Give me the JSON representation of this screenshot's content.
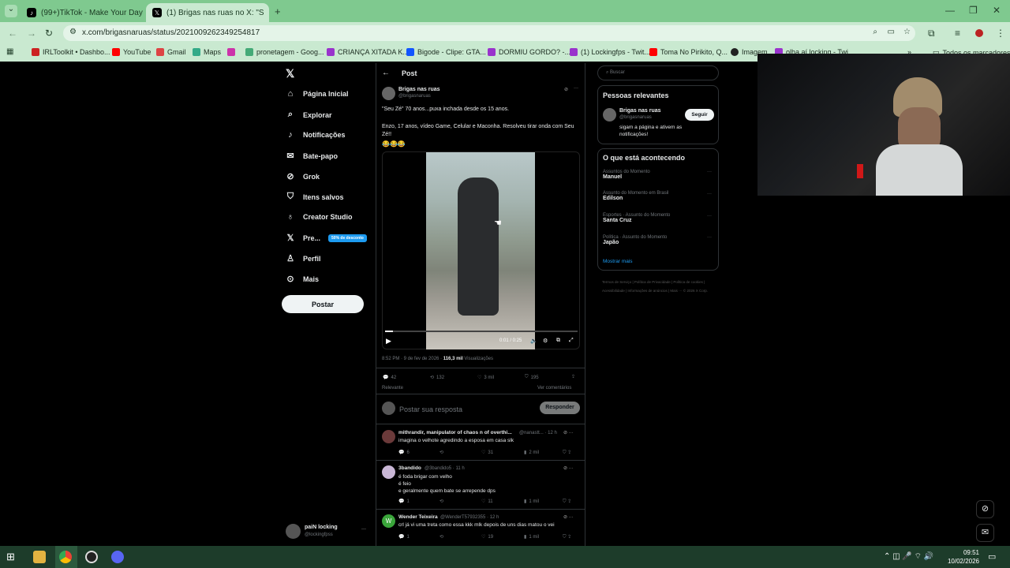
{
  "browser": {
    "tabs": [
      {
        "label": "(99+)TikTok - Make Your Day"
      },
      {
        "label": "(1) Brigas nas ruas no X: \"S"
      }
    ],
    "url": "x.com/brigasnaruas/status/2021009262349254817",
    "bookmarks": [
      "IRLToolkit • Dashbo...",
      "YouTube",
      "Gmail",
      "Maps",
      "pronetagem - Goog...",
      "CRIANÇA XITADA K...",
      "Bigode - Clipe: GTA...",
      "DORMIU GORDO? -...",
      "(1) Lockingfps - Twit...",
      "Toma No Pirikito, Q...",
      "Imagem",
      "olha aí locking - Twi..."
    ],
    "all_bookmarks": "Todos os marcadores",
    "colors": {
      "chrome": "#c9e9d0",
      "tabstrip": "#7fc98f"
    }
  },
  "nav": {
    "items": [
      "Página Inicial",
      "Explorar",
      "Notificações",
      "Bate-papo",
      "Grok",
      "Itens salvos",
      "Creator Studio",
      "Pre...",
      "Perfil",
      "Mais"
    ],
    "premium_badge": "50% de desconto",
    "post_button": "Postar",
    "account_name": "paiN locking",
    "account_handle": "@lockingfpss"
  },
  "post": {
    "header": "Post",
    "author": "Brigas nas ruas",
    "handle": "@brigasnaruas",
    "text1": "\"Seu Zé\" 70 anos...puxa inchada desde os 15 anos.",
    "text2": "Enzo, 17 anos, vídeo Game,  Celular e Maconha. Resolveu tirar onda com Seu Zé!!",
    "emoji": "😂😂😂",
    "video_time": "0:01 / 0:25",
    "video_progress": 0.04,
    "meta_time": "8:52 PM · 9 de fev de 2026 · ",
    "views_count": "116,3 mil",
    "views_label": " Visualizações",
    "stats": {
      "replies": "42",
      "reposts": "132",
      "likes": "3 mil",
      "bookmarks": "195"
    },
    "relevant": "Relevante",
    "see_quotes": "Ver comentários",
    "reply_placeholder": "Postar sua resposta",
    "reply_button": "Responder"
  },
  "replies": [
    {
      "name": "mithrandir, manipulator of chaos n of overthi...",
      "handle": "@nanastt...",
      "time": "· 12 h",
      "text": "imagina o velhote agredindo a esposa em casa slk",
      "r": "6",
      "rt": "",
      "l": "31",
      "v": "2 mil"
    },
    {
      "name": "3bandido",
      "handle": "@3bandido5",
      "time": "· 11 h",
      "text": "é foda brigar com velho\né feio\ne geralmente quem bate se arrepende dps",
      "r": "1",
      "rt": "",
      "l": "11",
      "v": "1 mil"
    },
    {
      "name": "Wender Teixeira",
      "handle": "@WenderT57932355",
      "time": "· 12 h",
      "text": "crl já vi uma treta como essa kkk mlk depois de uns dias matou o vei",
      "r": "1",
      "rt": "",
      "l": "19",
      "v": "1 mil"
    }
  ],
  "sidebar": {
    "search_placeholder": "Buscar",
    "relevant_title": "Pessoas relevantes",
    "person_name": "Brigas nas ruas",
    "person_handle": "@brigasnaruas",
    "person_bio": "sigam a página e ativem as notificações!",
    "follow": "Seguir",
    "trends_title": "O que está acontecendo",
    "trends": [
      {
        "context": "Assuntos do Momento",
        "name": "Manuel"
      },
      {
        "context": "Assunto do Momento em Brasil",
        "name": "Edilson"
      },
      {
        "context": "Esportes · Assunto do Momento",
        "name": "Santa Cruz"
      },
      {
        "context": "Política · Assunto do Momento",
        "name": "Japão"
      }
    ],
    "show_more": "Mostrar mais",
    "footer": "Termos de Serviço  |  Política de Privacidade  |  Política de cookies  |  Acessibilidade  |  Informações de anúncios  |  Mais ···  © 2026 X Corp."
  },
  "taskbar": {
    "time": "09:51",
    "date": "10/02/2026"
  }
}
